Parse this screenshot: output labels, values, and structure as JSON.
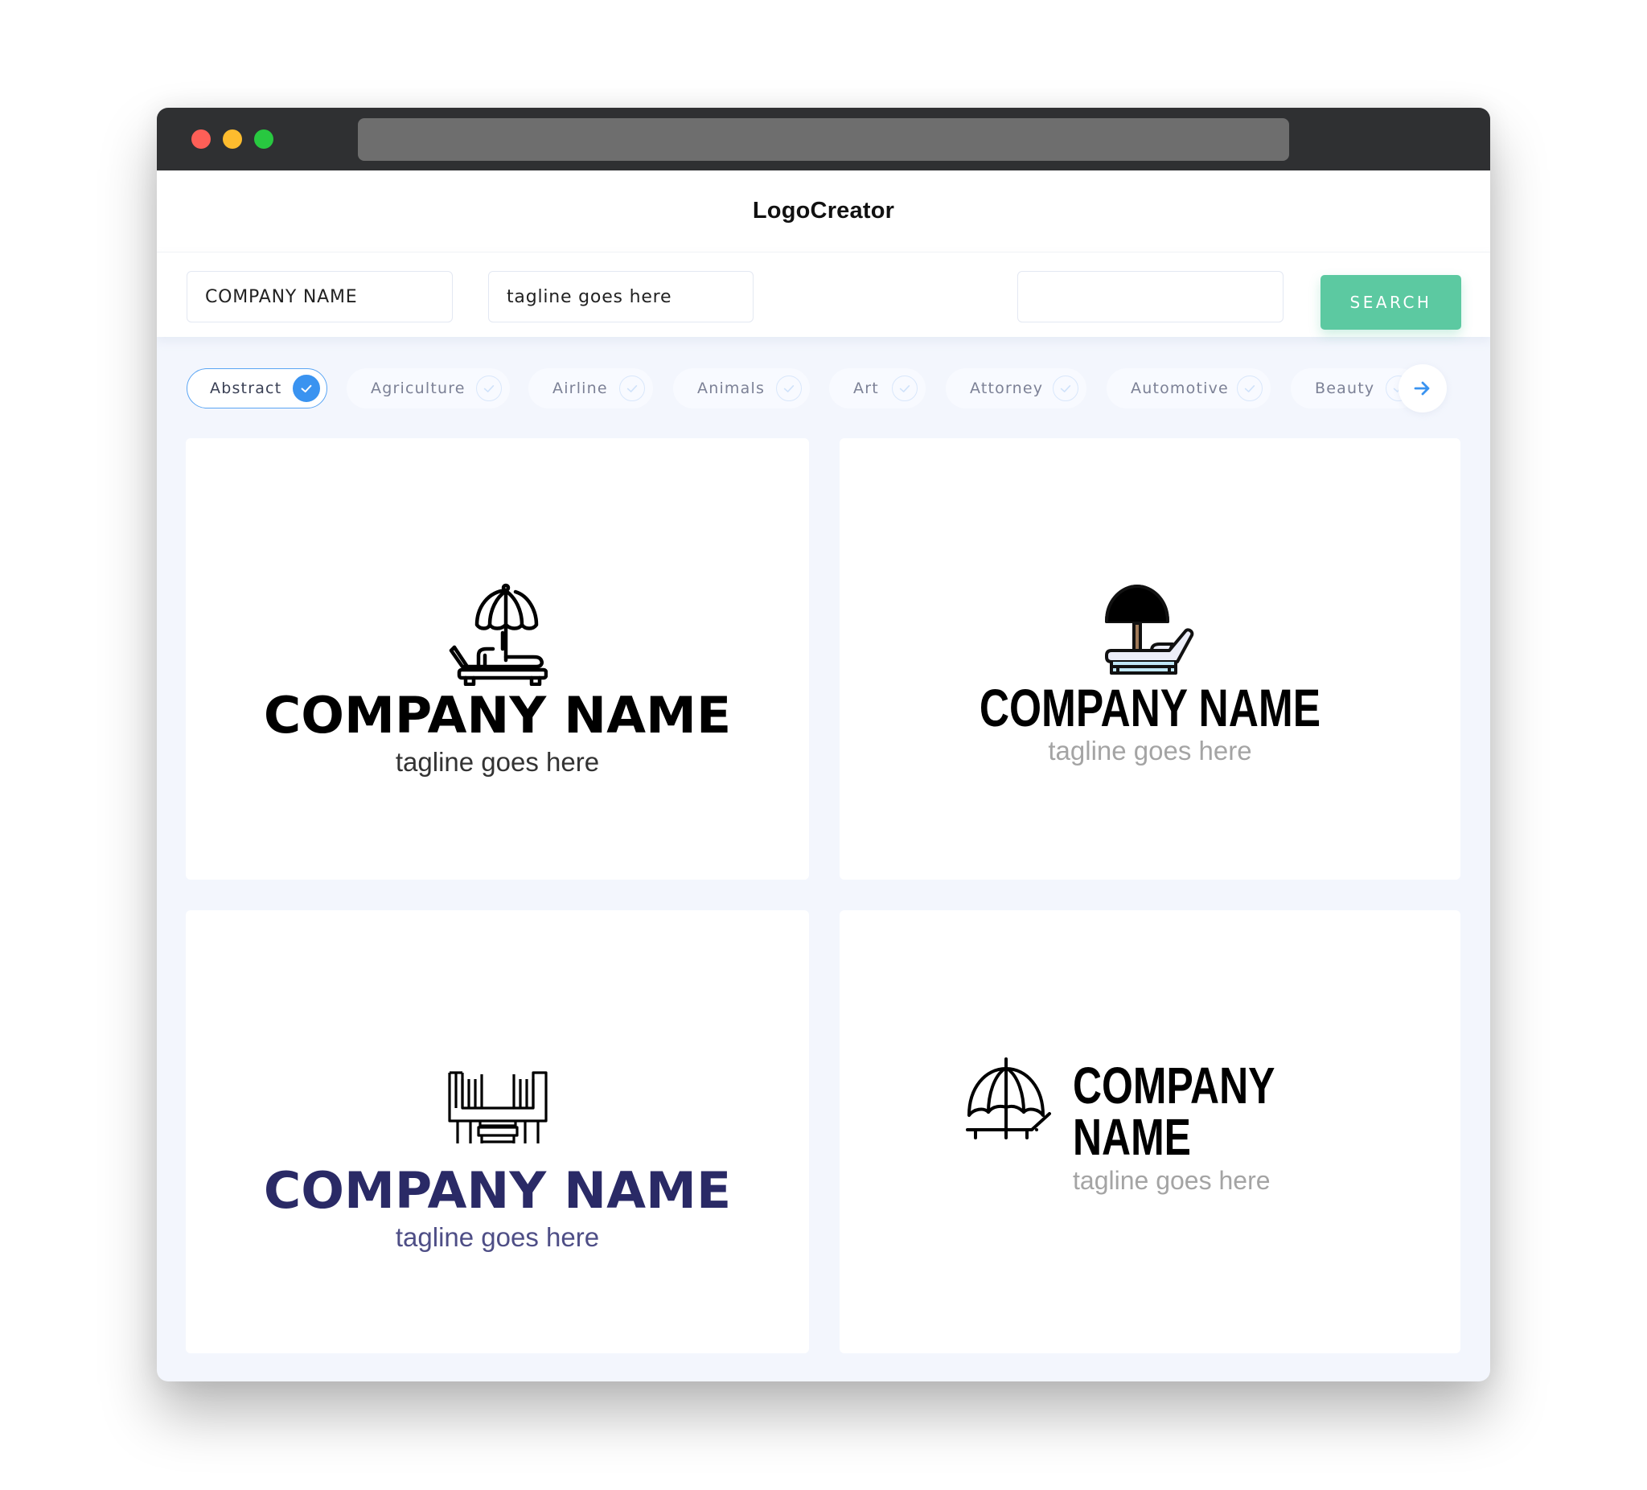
{
  "window": {
    "controls": [
      "close",
      "minimize",
      "maximize"
    ]
  },
  "header": {
    "title": "LogoCreator"
  },
  "search": {
    "company_name_value": "COMPANY NAME",
    "tagline_value": "tagline goes here",
    "keyword_value": "",
    "button_label": "SEARCH"
  },
  "categories": [
    {
      "label": "Abstract",
      "selected": true
    },
    {
      "label": "Agriculture",
      "selected": false
    },
    {
      "label": "Airline",
      "selected": false
    },
    {
      "label": "Animals",
      "selected": false
    },
    {
      "label": "Art",
      "selected": false
    },
    {
      "label": "Attorney",
      "selected": false
    },
    {
      "label": "Automotive",
      "selected": false
    },
    {
      "label": "Beauty",
      "selected": false
    }
  ],
  "logos": [
    {
      "icon": "beach-chair-umbrella-outline-icon",
      "company": "COMPANY NAME",
      "tagline": "tagline goes here",
      "name_color": "#000000",
      "tagline_color": "#333333"
    },
    {
      "icon": "beach-chair-umbrella-color-icon",
      "company": "COMPANY NAME",
      "tagline": "tagline goes here",
      "name_color": "#000000",
      "tagline_color": "#a4a4a4"
    },
    {
      "icon": "deck-chairs-icon",
      "company": "COMPANY NAME",
      "tagline": "tagline goes here",
      "name_color": "#2a2a66",
      "tagline_color": "#4e4e86"
    },
    {
      "icon": "umbrella-lounger-icon",
      "company": "COMPANY NAME",
      "tagline": "tagline goes here",
      "name_color": "#000000",
      "tagline_color": "#a4a4a4"
    }
  ],
  "colors": {
    "accent": "#5cc9a1",
    "selected_chip": "#3a93f0",
    "umbrella_red": "#f0606b",
    "umbrella_mint": "#a8ecd6"
  }
}
